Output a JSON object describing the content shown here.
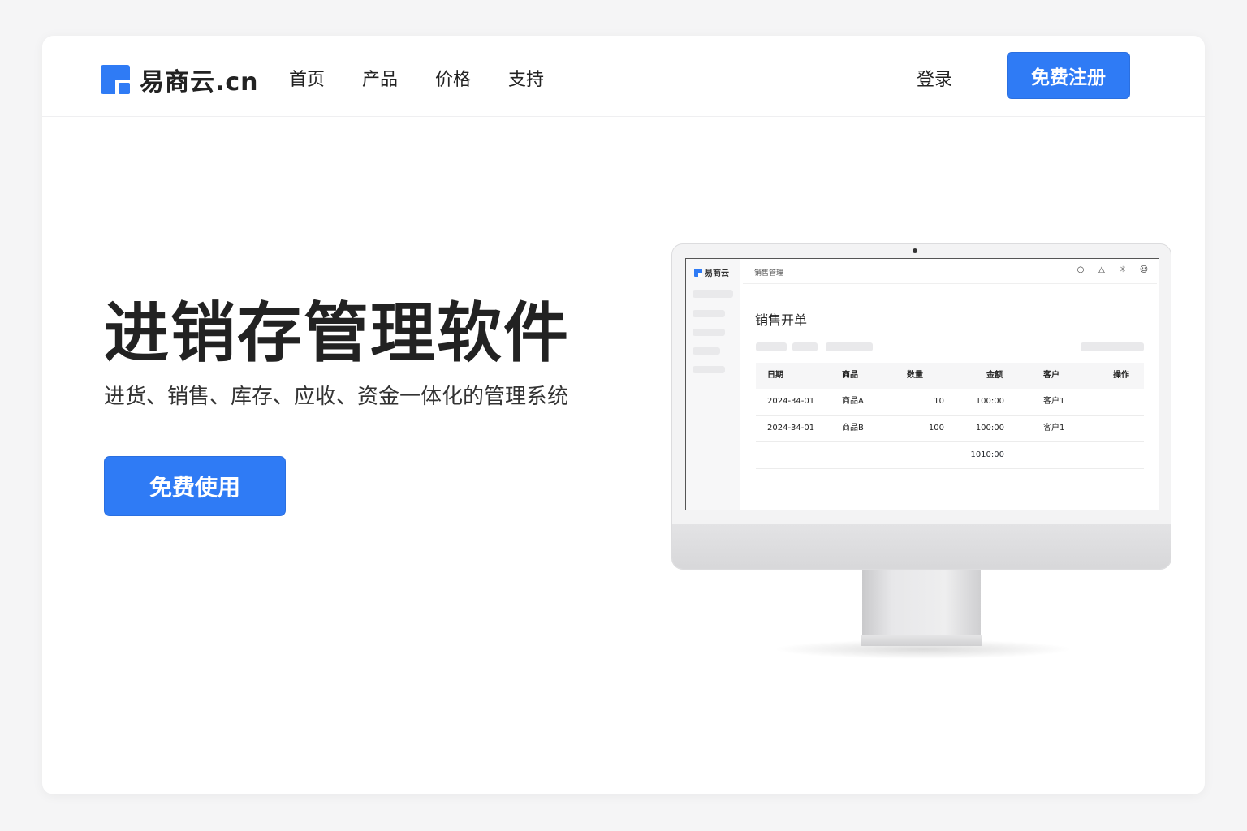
{
  "brand": {
    "name": "易商云.cn"
  },
  "nav": {
    "items": [
      {
        "label": "首页"
      },
      {
        "label": "产品"
      },
      {
        "label": "价格"
      },
      {
        "label": "支持"
      }
    ],
    "login_label": "登录",
    "signup_label": "免费注册"
  },
  "hero": {
    "title": "进销存管理软件",
    "subtitle": "进货、销售、库存、应收、资金一体化的管理系统",
    "cta_label": "免费使用"
  },
  "screen": {
    "app_name": "易商云",
    "breadcrumb": "销售管理",
    "page_title": "销售开单",
    "icons": [
      "refresh-icon",
      "bell-icon",
      "settings-icon",
      "user-icon"
    ],
    "table": {
      "columns": [
        "日期",
        "商品",
        "数量",
        "金额",
        "客户",
        "操作"
      ],
      "rows": [
        [
          "2024-34-01",
          "商品A",
          "10",
          "100:00",
          "客户1",
          ""
        ],
        [
          "2024-34-01",
          "商品B",
          "100",
          "100:00",
          "客户1",
          ""
        ]
      ],
      "total": "1010:00"
    }
  },
  "colors": {
    "accent": "#2f7bf5",
    "text": "#222222"
  }
}
